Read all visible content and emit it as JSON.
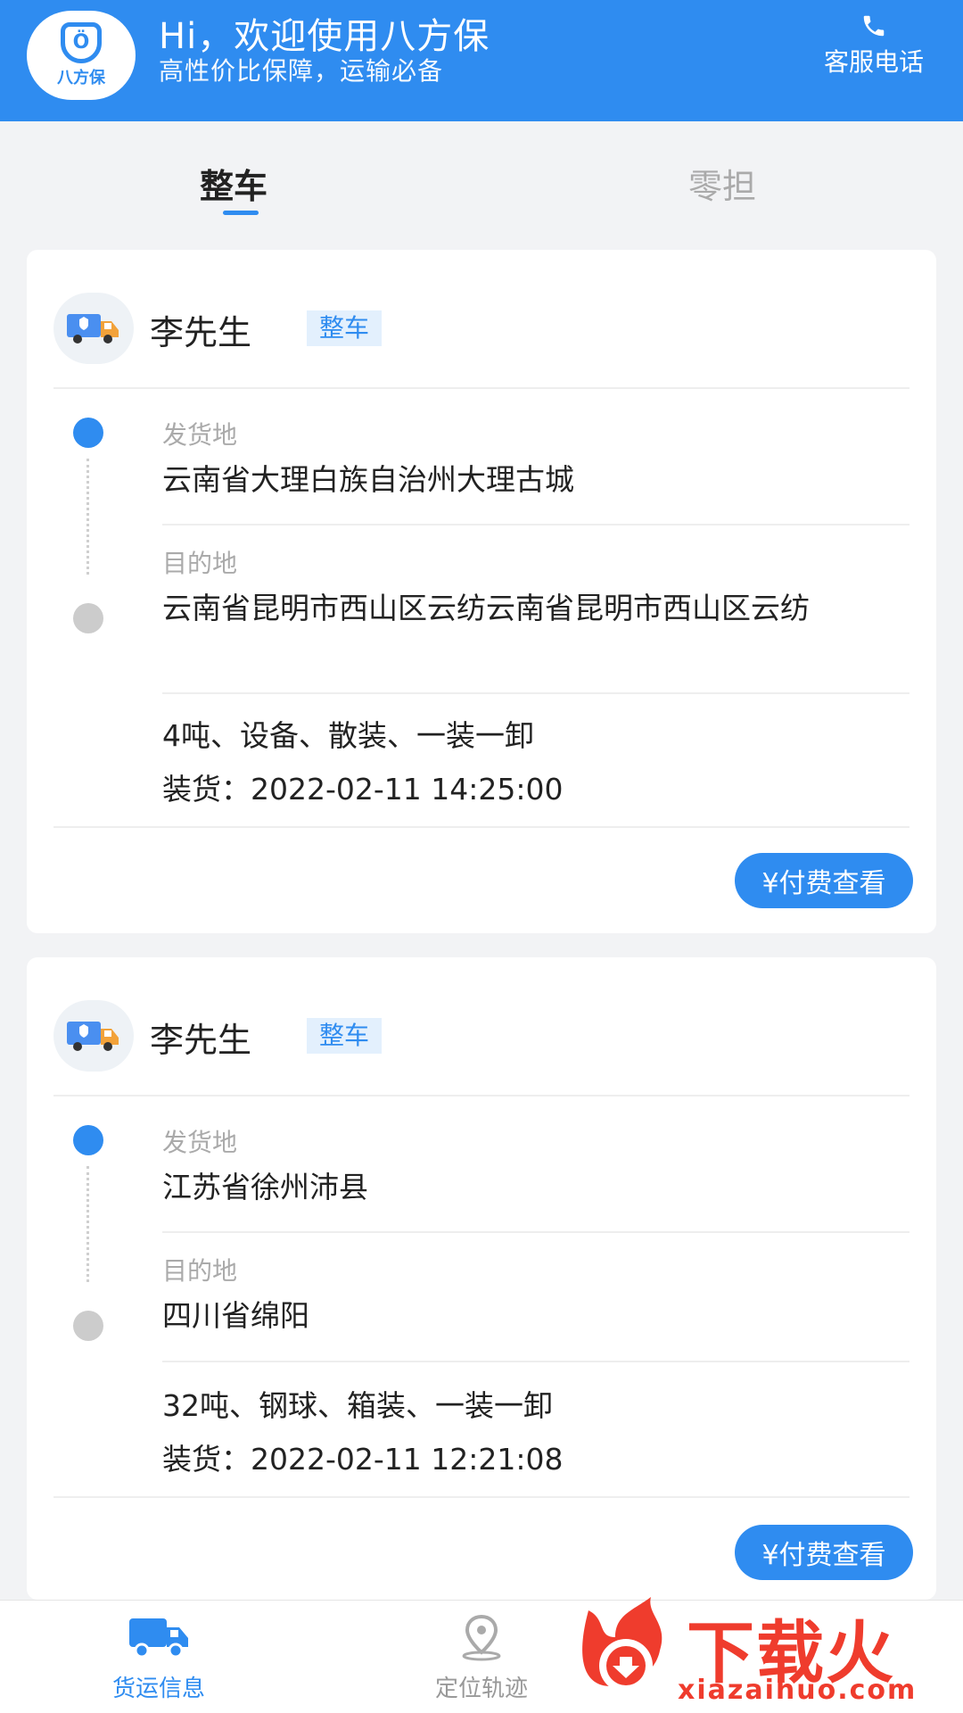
{
  "header": {
    "logo_text": "八方保",
    "title": "Hi，欢迎使用八方保",
    "subtitle": "高性价比保障，运输必备",
    "service_label": "客服电话",
    "service_icon": "phone-icon"
  },
  "tabs": [
    {
      "label": "整车",
      "active": true
    },
    {
      "label": "零担",
      "active": false
    }
  ],
  "orders": [
    {
      "name": "李先生",
      "badge": "整车",
      "origin_label": "发货地",
      "origin": "云南省大理白族自治州大理古城",
      "dest_label": "目的地",
      "dest": "云南省昆明市西山区云纺云南省昆明市西山区云纺",
      "cargo": "4吨、设备、散装、一装一卸",
      "loading": "装货：2022-02-11 14:25:00",
      "pay_label": "¥付费查看"
    },
    {
      "name": "李先生",
      "badge": "整车",
      "origin_label": "发货地",
      "origin": "江苏省徐州沛县",
      "dest_label": "目的地",
      "dest": "四川省绵阳",
      "cargo": "32吨、钢球、箱装、一装一卸",
      "loading": "装货：2022-02-11 12:21:08",
      "pay_label": "¥付费查看"
    }
  ],
  "bottom_nav": [
    {
      "label": "货运信息",
      "icon": "truck-icon",
      "active": true
    },
    {
      "label": "定位轨迹",
      "icon": "location-pin-icon",
      "active": false
    }
  ],
  "watermark": {
    "main": "下载火",
    "url": "xiazaihuo.com"
  },
  "colors": {
    "accent": "#2f8cf0",
    "background": "#f2f3f5",
    "watermark": "#ef3c2d"
  }
}
